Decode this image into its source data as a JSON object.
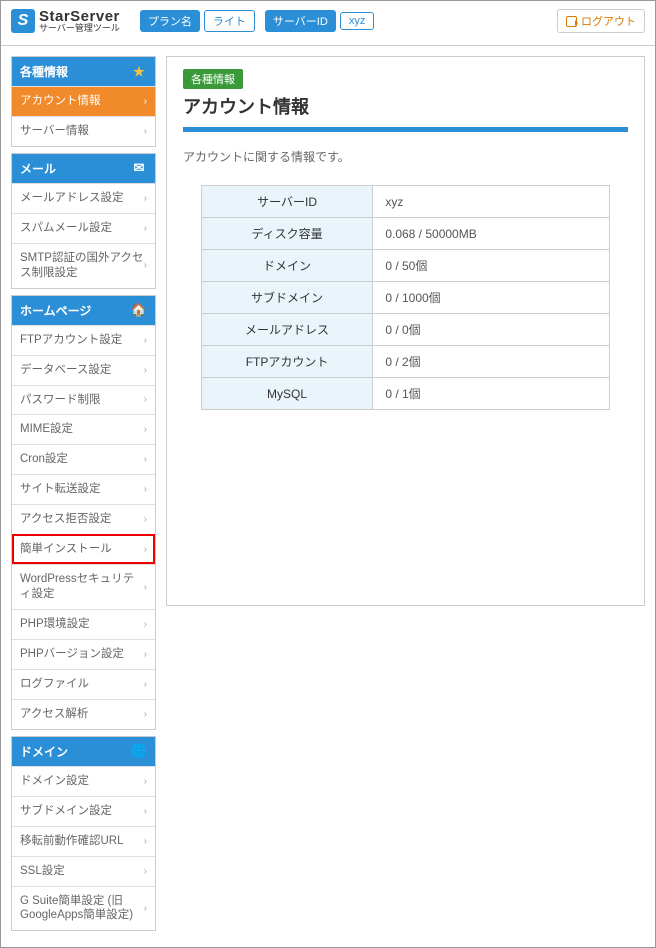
{
  "header": {
    "logo_title": "StarServer",
    "logo_sub": "サーバー管理ツール",
    "plan_label": "プラン名",
    "plan_value": "ライト",
    "server_label": "サーバーID",
    "server_value": "xyz",
    "logout": "ログアウト"
  },
  "sidebar": [
    {
      "title": "各種情報",
      "icon": "star",
      "items": [
        {
          "label": "アカウント情報",
          "active": true
        },
        {
          "label": "サーバー情報"
        }
      ]
    },
    {
      "title": "メール",
      "icon": "mail",
      "items": [
        {
          "label": "メールアドレス設定"
        },
        {
          "label": "スパムメール設定"
        },
        {
          "label": "SMTP認証の国外アクセス制限設定"
        }
      ]
    },
    {
      "title": "ホームページ",
      "icon": "home",
      "items": [
        {
          "label": "FTPアカウント設定"
        },
        {
          "label": "データベース設定"
        },
        {
          "label": "パスワード制限"
        },
        {
          "label": "MIME設定"
        },
        {
          "label": "Cron設定"
        },
        {
          "label": "サイト転送設定"
        },
        {
          "label": "アクセス拒否設定"
        },
        {
          "label": "簡単インストール",
          "highlight": true
        },
        {
          "label": "WordPressセキュリティ設定"
        },
        {
          "label": "PHP環境設定"
        },
        {
          "label": "PHPバージョン設定"
        },
        {
          "label": "ログファイル"
        },
        {
          "label": "アクセス解析"
        }
      ]
    },
    {
      "title": "ドメイン",
      "icon": "globe",
      "items": [
        {
          "label": "ドメイン設定"
        },
        {
          "label": "サブドメイン設定"
        },
        {
          "label": "移転前動作確認URL"
        },
        {
          "label": "SSL設定"
        },
        {
          "label": "G Suite簡単設定 (旧GoogleApps簡単設定)"
        }
      ]
    }
  ],
  "main": {
    "badge": "各種情報",
    "title": "アカウント情報",
    "desc": "アカウントに関する情報です。",
    "rows": [
      {
        "k": "サーバーID",
        "v": "xyz"
      },
      {
        "k": "ディスク容量",
        "v": "0.068 / 50000MB"
      },
      {
        "k": "ドメイン",
        "v": "0 / 50個"
      },
      {
        "k": "サブドメイン",
        "v": "0 / 1000個"
      },
      {
        "k": "メールアドレス",
        "v": "0 / 0個"
      },
      {
        "k": "FTPアカウント",
        "v": "0 / 2個"
      },
      {
        "k": "MySQL",
        "v": "0 / 1個"
      }
    ]
  }
}
